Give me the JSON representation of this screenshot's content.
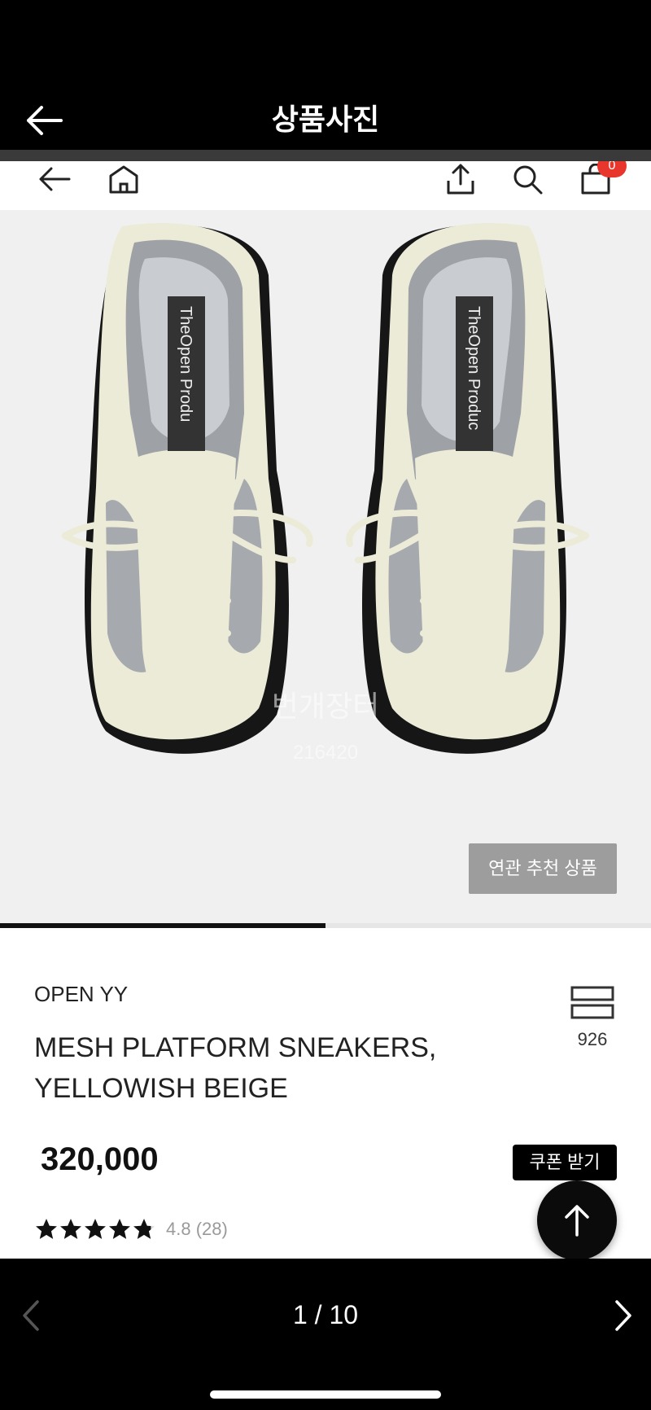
{
  "header": {
    "title": "상품사진",
    "back_icon": "arrow-left-icon"
  },
  "inner_nav": {
    "icons": [
      "arrow-left-icon",
      "home-icon",
      "share-icon",
      "search-icon",
      "cart-icon"
    ],
    "cart_count": "0",
    "badge_color": "#e8362d"
  },
  "image": {
    "shoe_label_left": "TheOpen Produ",
    "shoe_label_right": "TheOpen Produc",
    "watermark_text": "번개장터",
    "watermark_number": "216420",
    "related_label": "연관 추천 상품",
    "progress_fraction": 0.5
  },
  "product": {
    "brand": "OPEN YY",
    "name": "MESH PLATFORM SNEAKERS, YELLOWISH BEIGE",
    "list_count": "926",
    "price": "320,000",
    "coupon_label": "쿠폰 받기",
    "rating_value": 4.8,
    "rating_text": "4.8 (28)"
  },
  "footer": {
    "page_indicator": "1 / 10",
    "prev_icon": "chevron-left-icon",
    "next_icon": "chevron-right-icon"
  }
}
